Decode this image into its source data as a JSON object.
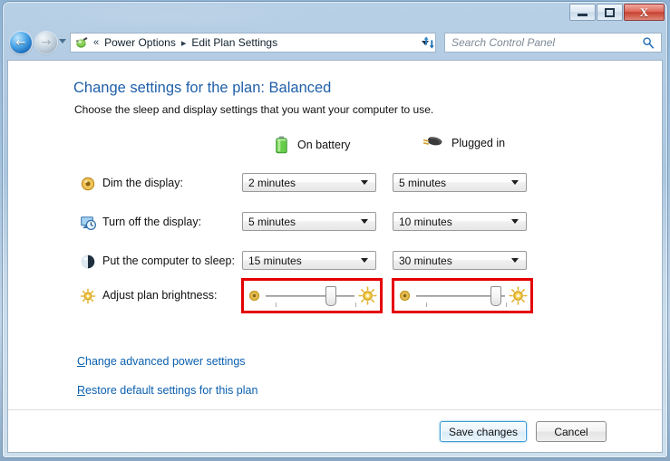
{
  "window": {
    "caption_buttons": [
      {
        "name": "minimize",
        "glyph": "minimize-icon"
      },
      {
        "name": "maximize",
        "glyph": "maximize-icon"
      },
      {
        "name": "close",
        "glyph": "close-icon",
        "label": "X"
      }
    ]
  },
  "navbar": {
    "back_arrow": "←",
    "forward_arrow": "→",
    "breadcrumb_icon": "power-options-icon",
    "breadcrumb_overflow": "«",
    "breadcrumb": [
      {
        "label": "Power Options"
      },
      {
        "label": "Edit Plan Settings"
      }
    ],
    "breadcrumb_separator": "▸",
    "refresh_icon": "refresh-icon",
    "search": {
      "placeholder": "Search Control Panel",
      "value": "",
      "icon": "search-icon"
    }
  },
  "page": {
    "title": "Change settings for the plan: Balanced",
    "subtitle": "Choose the sleep and display settings that you want your computer to use."
  },
  "columns": [
    {
      "key": "battery",
      "label": "On battery",
      "icon": "battery-icon"
    },
    {
      "key": "plugged",
      "label": "Plugged in",
      "icon": "power-plug-icon"
    }
  ],
  "settings": [
    {
      "id": "dim",
      "icon": "dim-display-icon",
      "label": "Dim the display:",
      "battery": "2 minutes",
      "plugged": "5 minutes"
    },
    {
      "id": "turnoff",
      "icon": "turn-off-display-icon",
      "label": "Turn off the display:",
      "battery": "5 minutes",
      "plugged": "10 minutes"
    },
    {
      "id": "sleep",
      "icon": "sleep-icon",
      "label": "Put the computer to sleep:",
      "battery": "15 minutes",
      "plugged": "30 minutes"
    }
  ],
  "brightness": {
    "icon": "brightness-icon",
    "label": "Adjust plan brightness:",
    "dim_icon": "sun-dim-icon",
    "bright_icon": "sun-bright-icon",
    "battery_percent": 72,
    "plugged_percent": 89,
    "highlight_color": "#e40000"
  },
  "links": [
    {
      "id": "advanced",
      "accel": "C",
      "rest": "hange advanced power settings"
    },
    {
      "id": "restore",
      "accel": "R",
      "rest": "estore default settings for this plan"
    }
  ],
  "buttons": {
    "save": "Save changes",
    "cancel": "Cancel"
  },
  "colors": {
    "title_blue": "#1f5FA9",
    "link_blue": "#0a5faf",
    "highlight_red": "#e40000",
    "battery_green": "#4fb33a"
  }
}
